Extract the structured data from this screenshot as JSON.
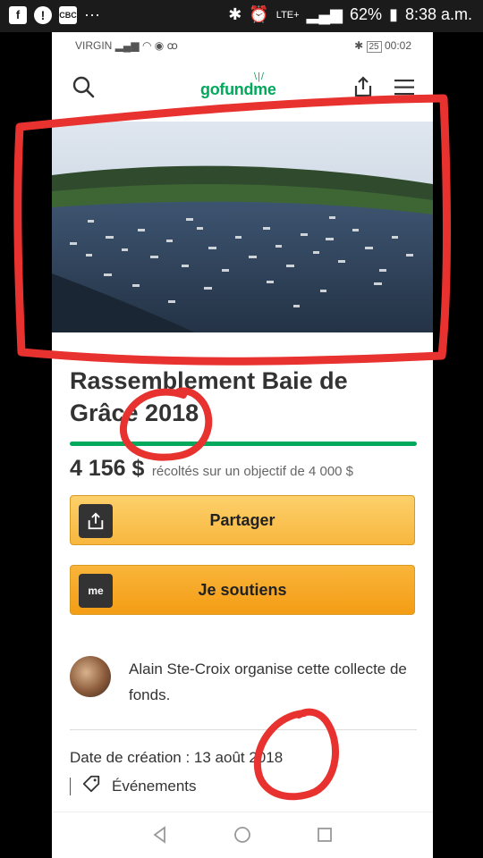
{
  "outer_status": {
    "icons": [
      "facebook-icon",
      "alert-icon",
      "cbc-icon",
      "more-icon"
    ],
    "more": "···",
    "network": "LTE+",
    "battery": "62%",
    "time": "8:38 a.m."
  },
  "inner_status": {
    "carrier": "VIRGIN",
    "battery": "25",
    "time": "00:02"
  },
  "header": {
    "logo": "gofundme"
  },
  "campaign": {
    "title": "Rassemblement Baie de Grâce 2018",
    "amount": "4 156 $",
    "goal_text": "récoltés sur un objectif de 4 000 $",
    "progress": 1.0,
    "share_label": "Partager",
    "donate_label": "Je soutiens",
    "donate_icon_text": "me",
    "organizer_text": "Alain Ste-Croix organise cette collecte de fonds.",
    "created": "Date de création : 13 août 2018",
    "category": "Événements"
  },
  "colors": {
    "brand": "#02a95c",
    "annotation": "#e8322f",
    "share_button": "#f8b73e",
    "donate_button": "#f49d15"
  }
}
